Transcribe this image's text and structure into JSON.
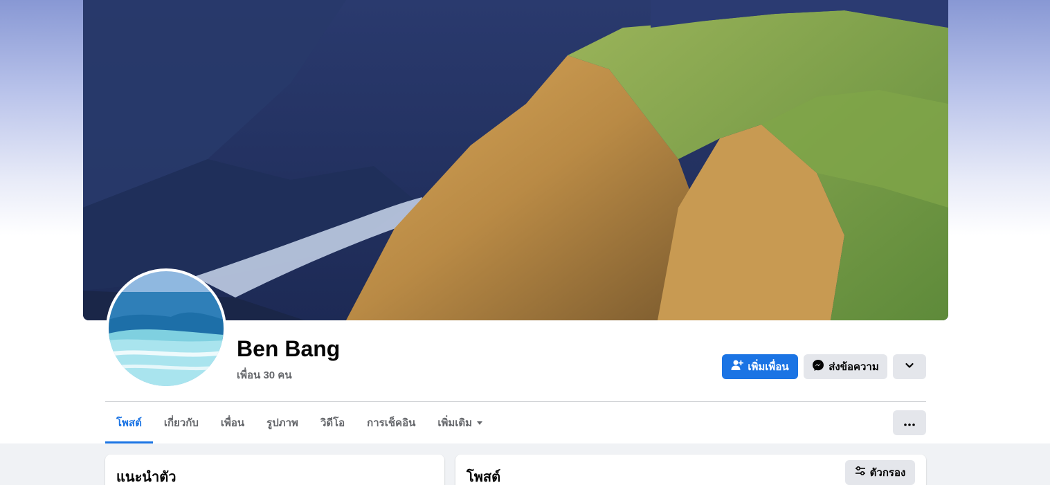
{
  "profile": {
    "name": "Ben Bang",
    "friends_text": "เพื่อน 30 คน"
  },
  "actions": {
    "add_friend": "เพิ่มเพื่อน",
    "message": "ส่งข้อความ"
  },
  "tabs": [
    {
      "label": "โพสต์",
      "active": true
    },
    {
      "label": "เกี่ยวกับ"
    },
    {
      "label": "เพื่อน"
    },
    {
      "label": "รูปภาพ"
    },
    {
      "label": "วิดีโอ"
    },
    {
      "label": "การเช็คอิน"
    },
    {
      "label": "เพิ่มเติม"
    }
  ],
  "intro_card": {
    "title": "แนะนำตัว"
  },
  "posts_card": {
    "title": "โพสต์",
    "filter_label": "ตัวกรอง"
  },
  "colors": {
    "primary": "#1b74e4",
    "secondary_button": "#e4e6eb",
    "muted_text": "#65676b"
  }
}
